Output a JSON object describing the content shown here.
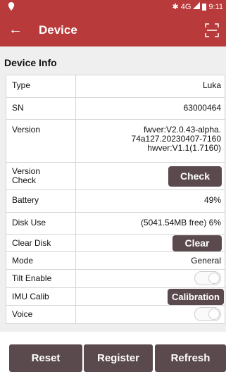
{
  "status_bar": {
    "left_icon": "location-pin-icon",
    "bluetooth_glyph": "✱",
    "network_text": "4G",
    "time": "9:11"
  },
  "app_bar": {
    "back_glyph": "←",
    "title": "Device",
    "scan_icon": "scan-icon"
  },
  "section": {
    "title": "Device Info"
  },
  "rows": {
    "type": {
      "label": "Type",
      "value": "Luka"
    },
    "sn": {
      "label": "SN",
      "value": "63000464"
    },
    "version": {
      "label": "Version",
      "line1": "fwver:V2.0.43-alpha.",
      "line2": "74a127.20230407-7160",
      "line3": "hwver:V1.1(1.7160)"
    },
    "version_check": {
      "label_line1": "Version",
      "label_line2": "Check",
      "button": "Check"
    },
    "battery": {
      "label": "Battery",
      "value": "49%"
    },
    "disk_use": {
      "label": "Disk Use",
      "value": "(5041.54MB free) 6%"
    },
    "clear_disk": {
      "label": "Clear Disk",
      "button": "Clear"
    },
    "mode": {
      "label": "Mode",
      "value": "General"
    },
    "tilt_enable": {
      "label": "Tilt Enable",
      "toggle_on": false
    },
    "imu_calib": {
      "label": "IMU Calib",
      "button": "Calibration"
    },
    "voice": {
      "label": "Voice",
      "toggle_on": false
    }
  },
  "bottom": {
    "reset": "Reset",
    "register": "Register",
    "refresh": "Refresh"
  },
  "colors": {
    "header": "#b93a3a",
    "button": "#5b4a4d",
    "background": "#efefef"
  }
}
